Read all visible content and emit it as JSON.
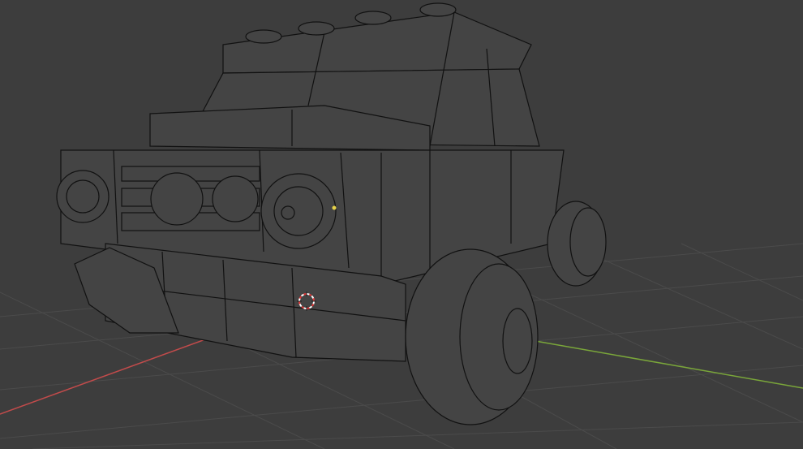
{
  "viewport": {
    "background": "#3d3d3d",
    "grid_color": "#4a4a4a",
    "x_axis_color": "#c24b4b",
    "y_axis_color": "#7aa63a",
    "wire_color": "#111111",
    "face_color": "#444444",
    "cursor_colors": [
      "#ffffff",
      "#e03535"
    ],
    "selected_vertex_color": "#e6d24a"
  },
  "model": {
    "name_icon": "lego-truck-mesh"
  }
}
